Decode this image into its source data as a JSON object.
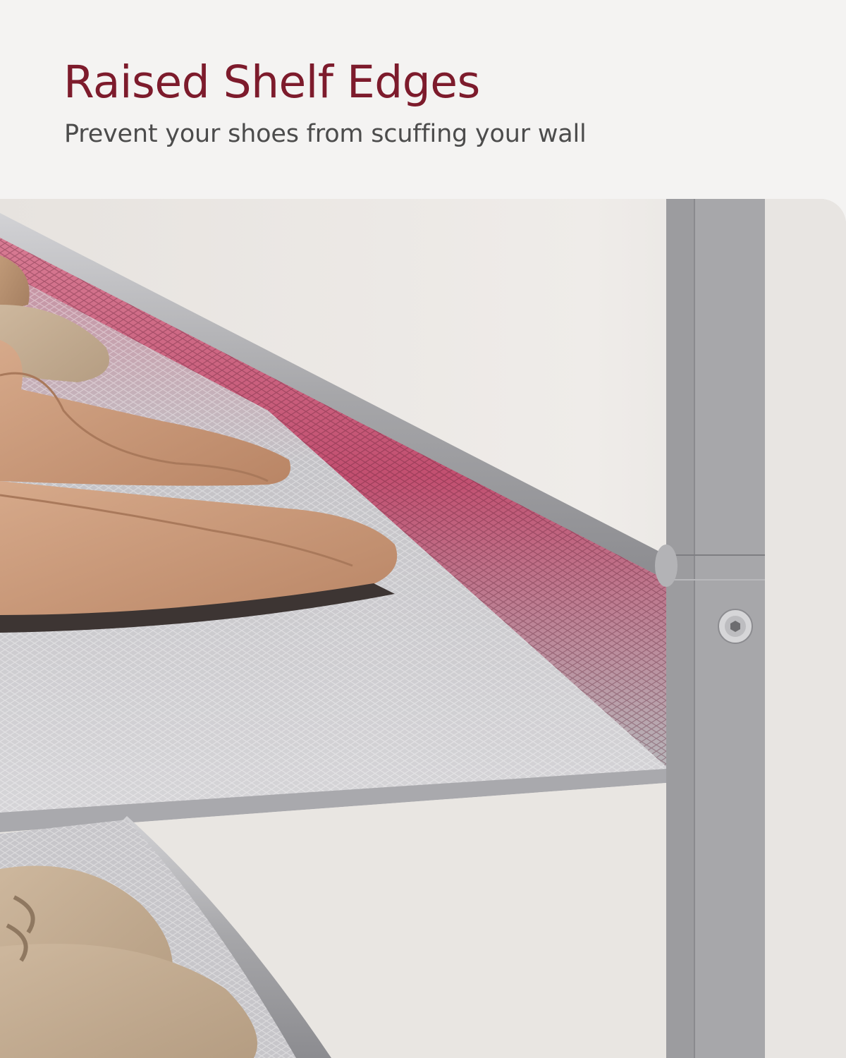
{
  "header": {
    "title": "Raised Shelf Edges",
    "subtitle": "Prevent your shoes from scuffing your wall"
  },
  "colors": {
    "title": "#7d1b2c",
    "subtitle": "#4c4c4c",
    "background": "#f4f3f2",
    "frame": "#9a9a9c",
    "highlight": "#c94d6e"
  },
  "photo": {
    "icons": [
      "shoe-rack-photo",
      "loafer-shoe",
      "screw-bolt"
    ]
  }
}
